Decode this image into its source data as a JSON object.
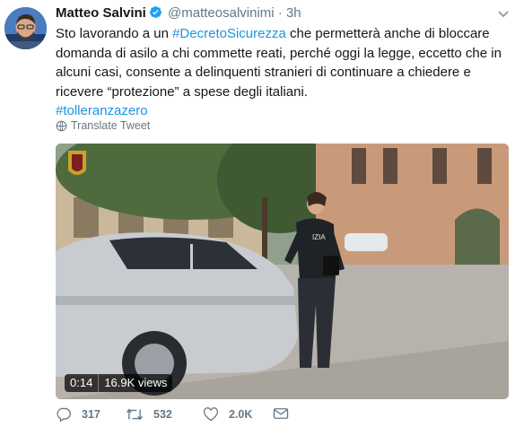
{
  "tweet": {
    "author_name": "Matteo Salvini",
    "handle": "@matteosalvinimi",
    "separator": "·",
    "time": "3h",
    "text_before_hashtag": "Sto lavorando a un ",
    "hashtag_inline": "#DecretoSicurezza",
    "text_after_hashtag": " che permetterà anche di bloccare domanda di asilo a chi commette reati, perché oggi la legge, eccetto che in alcuni casi, consente a delinquenti stranieri di continuare a chiedere e ricevere “protezione” a spese degli italiani.",
    "hashtag_footer": "#tolleranzazero",
    "translate_label": "Translate Tweet"
  },
  "video": {
    "duration": "0:14",
    "views": "16.9K views",
    "vest_text": "IZIA"
  },
  "actions": {
    "reply_count": "317",
    "retweet_count": "532",
    "like_count": "2.0K"
  },
  "icons": {
    "reply": "reply-icon",
    "retweet": "retweet-icon",
    "like": "heart-icon",
    "dm": "envelope-icon",
    "globe": "globe-icon",
    "verified": "verified-badge-icon",
    "caret": "chevron-down-icon"
  },
  "colors": {
    "link": "#1b95e0",
    "muted": "#657786",
    "verified": "#1da1f2"
  }
}
